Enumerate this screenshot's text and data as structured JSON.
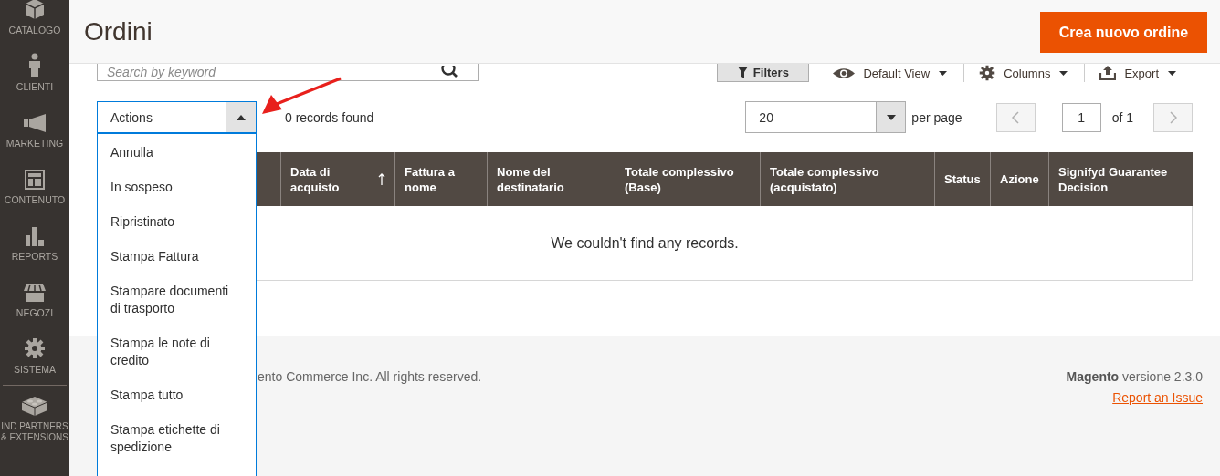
{
  "sidebar": {
    "items": [
      {
        "label": "CATALOGO"
      },
      {
        "label": "CLIENTI"
      },
      {
        "label": "MARKETING"
      },
      {
        "label": "CONTENUTO"
      },
      {
        "label": "REPORTS"
      },
      {
        "label": "NEGOZI"
      },
      {
        "label": "SISTEMA"
      },
      {
        "label": "IND PARTNERS & EXTENSIONS"
      }
    ]
  },
  "header": {
    "title": "Ordini",
    "primary_button": "Crea nuovo ordine"
  },
  "toolbar": {
    "search": {
      "placeholder": "Search by keyword"
    },
    "filters_button": "Filters",
    "view_menu": "Default View",
    "columns_menu": "Columns",
    "export_menu": "Export"
  },
  "actions": {
    "label": "Actions",
    "expanded": true,
    "options": [
      {
        "label": "Annulla"
      },
      {
        "label": "In sospeso"
      },
      {
        "label": "Ripristinato"
      },
      {
        "label": "Stampa Fattura"
      },
      {
        "label": "Stampare documenti di trasporto"
      },
      {
        "label": "Stampa le note di credito"
      },
      {
        "label": "Stampa tutto"
      },
      {
        "label": "Stampa etichette di spedizione"
      }
    ]
  },
  "records_found": "0 records found",
  "pagination": {
    "per_page": "20",
    "per_page_label": "per page",
    "previous_disabled": true,
    "page": "1",
    "page_total": "of 1",
    "next_disabled": true
  },
  "table": {
    "columns": [
      {
        "label": "Data di acquisto",
        "sorted": true
      },
      {
        "label": "Fattura a nome",
        "sorted": false
      },
      {
        "label": "Nome del destinatario",
        "sorted": false
      },
      {
        "label": "Totale complessivo (Base)",
        "sorted": false
      },
      {
        "label": "Totale complessivo (acquistato)",
        "sorted": false
      },
      {
        "label": "Status",
        "sorted": false
      },
      {
        "label": "Azione",
        "sorted": false
      },
      {
        "label": "Signifyd Guarantee Decision",
        "sorted": false
      }
    ],
    "empty_message": "We couldn't find any records."
  },
  "footer": {
    "copyright": "ento Commerce Inc. All rights reserved.",
    "version": "**Magento** versione 2.3.0",
    "report_link": "Report an Issue"
  }
}
